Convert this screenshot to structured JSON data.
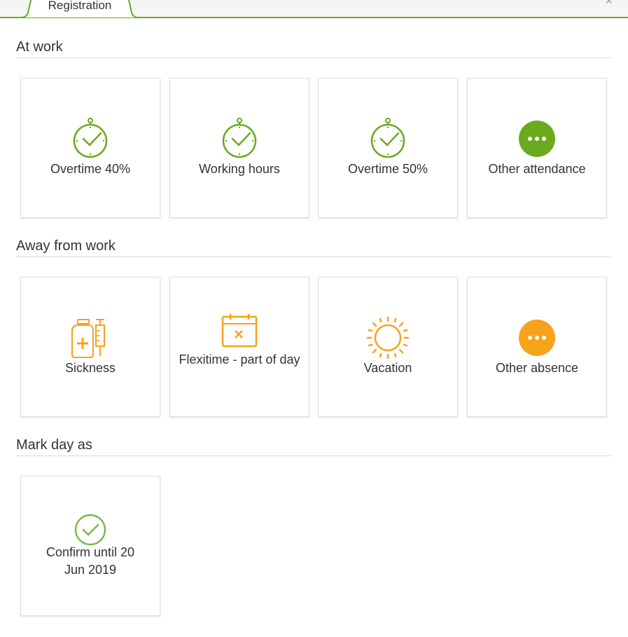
{
  "tab": {
    "label": "Registration",
    "close_glyph": "×"
  },
  "colors": {
    "green": "#6aaa1f",
    "orange": "#f7a21b",
    "light_green": "#7bb94a"
  },
  "sections": [
    {
      "title": "At work",
      "tiles": [
        {
          "label": "Overtime 40%",
          "icon": "stopwatch-check-icon"
        },
        {
          "label": "Working hours",
          "icon": "stopwatch-check-icon"
        },
        {
          "label": "Overtime 50%",
          "icon": "stopwatch-check-icon"
        },
        {
          "label": "Other attendance",
          "icon": "more-dots-icon"
        }
      ]
    },
    {
      "title": "Away from work",
      "tiles": [
        {
          "label": "Sickness",
          "icon": "medicine-syringe-icon"
        },
        {
          "label": "Flexitime - part of day",
          "icon": "calendar-x-icon"
        },
        {
          "label": "Vacation",
          "icon": "sun-icon"
        },
        {
          "label": "Other absence",
          "icon": "more-dots-icon"
        }
      ]
    },
    {
      "title": "Mark day as",
      "tiles": [
        {
          "label": "Confirm until 20 Jun 2019",
          "icon": "check-circle-icon"
        }
      ]
    }
  ]
}
